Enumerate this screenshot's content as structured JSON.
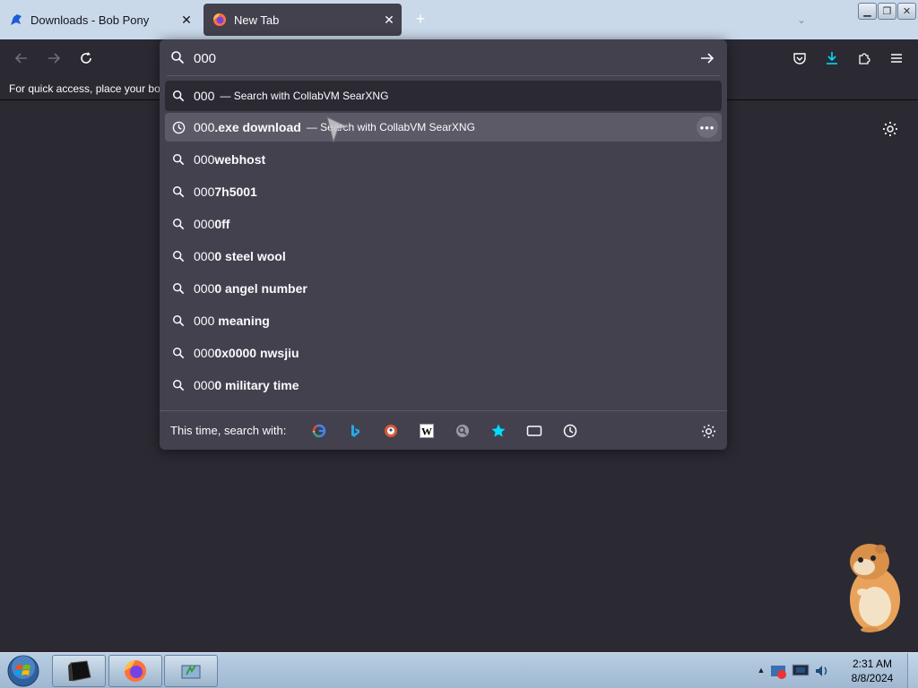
{
  "tabs": [
    {
      "title": "Downloads - Bob Pony",
      "active": false
    },
    {
      "title": "New Tab",
      "active": true
    }
  ],
  "bookmarks_hint": "For quick access, place your boo",
  "urlbar": {
    "value": "000",
    "results": [
      {
        "type": "search",
        "prefix": "000",
        "bold": "",
        "action": "— Search with CollabVM SearXNG"
      },
      {
        "type": "history",
        "prefix": "000",
        "bold": ".exe download",
        "action": "— Search with CollabVM SearXNG"
      },
      {
        "type": "search",
        "prefix": "000",
        "bold": "webhost",
        "action": ""
      },
      {
        "type": "search",
        "prefix": "000",
        "bold": "7h5001",
        "action": ""
      },
      {
        "type": "search",
        "prefix": "000",
        "bold": "0ff",
        "action": ""
      },
      {
        "type": "search",
        "prefix": "000",
        "bold": "0 steel wool",
        "action": ""
      },
      {
        "type": "search",
        "prefix": "000",
        "bold": "0 angel number",
        "action": ""
      },
      {
        "type": "search",
        "prefix": "000",
        "bold": " meaning",
        "action": ""
      },
      {
        "type": "search",
        "prefix": "000",
        "bold": "0x0000 nwsjiu",
        "action": ""
      },
      {
        "type": "search",
        "prefix": "000",
        "bold": "0 military time",
        "action": ""
      }
    ],
    "one_off_label": "This time, search with:",
    "one_off_engines": [
      "google-icon",
      "bing-icon",
      "duckduckgo-icon",
      "wikipedia-icon",
      "searxng-icon",
      "bookmarks-icon",
      "tabs-icon",
      "history-icon"
    ]
  },
  "clock": {
    "time": "2:31 AM",
    "date": "8/8/2024"
  },
  "colors": {
    "toolbar": "#2b2a33",
    "panel": "#42414d",
    "accent": "#00ddff",
    "taskbar": "#a9c1d8"
  }
}
